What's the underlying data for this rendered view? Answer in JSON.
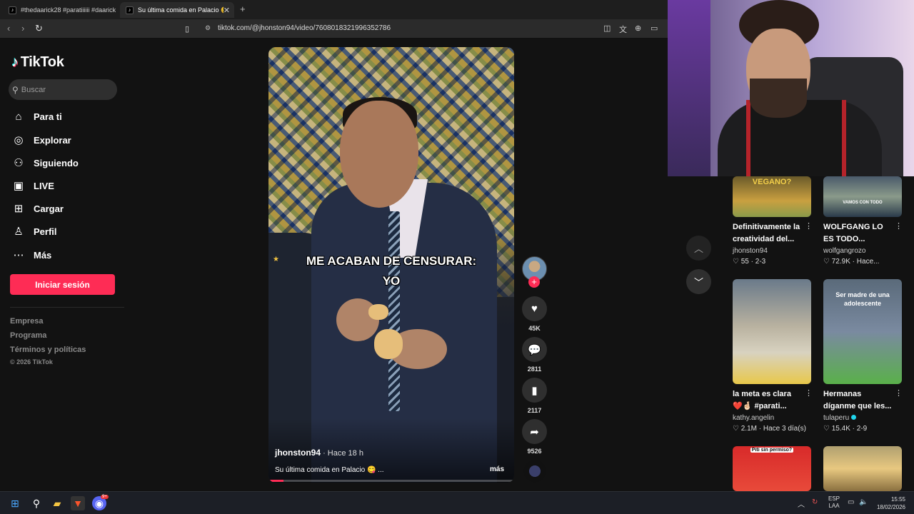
{
  "browser": {
    "tabs": [
      {
        "label": "#thedaarick28 #paratiiiiii #daarick #",
        "active": false
      },
      {
        "label": "Su última comida en Palacio 😋 |",
        "active": true
      }
    ],
    "url": "tiktok.com/@jhonston94/video/7608018321996352786"
  },
  "sidebar": {
    "brand": "TikTok",
    "search_placeholder": "Buscar",
    "nav": [
      {
        "label": "Para ti",
        "icon": "home-icon"
      },
      {
        "label": "Explorar",
        "icon": "compass-icon"
      },
      {
        "label": "Siguiendo",
        "icon": "following-icon"
      },
      {
        "label": "LIVE",
        "icon": "live-icon"
      },
      {
        "label": "Cargar",
        "icon": "upload-icon"
      },
      {
        "label": "Perfil",
        "icon": "profile-icon"
      },
      {
        "label": "Más",
        "icon": "more-icon"
      }
    ],
    "login_label": "Iniciar sesión",
    "footer_links": [
      "Empresa",
      "Programa",
      "Términos y políticas"
    ],
    "copyright": "© 2026 TikTok"
  },
  "video": {
    "overlay_line1": "ME ACABAN DE CENSURAR:",
    "overlay_line2": "YO",
    "author": "jhonston94",
    "time": " · Hace 18 h",
    "caption": "Su última comida en Palacio 😋 ...",
    "more": "más",
    "progress": 0.06
  },
  "actions": {
    "likes": "45K",
    "comments": "2811",
    "saves": "2117",
    "shares": "9526"
  },
  "related": [
    {
      "thumb_text": "VEGANO?",
      "title": "Definitivamente la creatividad del...",
      "author": "jhonston94",
      "likes": "55",
      "meta": "2-3",
      "verified": false
    },
    {
      "thumb_text": "VAMOS CON TODO",
      "title": "WOLFGANG LO ES TODO...",
      "author": "wolfgangrozo",
      "likes": "72.9K",
      "meta": "Hace...",
      "verified": false
    },
    {
      "thumb_text": "",
      "title": "la meta es clara ❤️🤞🏻 #parati...",
      "author": "kathy.angelin",
      "likes": "2.1M",
      "meta": "Hace 3 día(s)",
      "verified": false
    },
    {
      "thumb_text": "Ser madre de una adolescente",
      "title": "Hermanas díganme que les...",
      "author": "tulaperu",
      "likes": "15.4K",
      "meta": "2-9",
      "verified": true
    },
    {
      "thumb_text": "Piti sin permiso?",
      "title": "",
      "author": "",
      "likes": "",
      "meta": "",
      "verified": false
    },
    {
      "thumb_text": "",
      "title": "",
      "author": "",
      "likes": "",
      "meta": "",
      "verified": false
    }
  ],
  "taskbar": {
    "lang_line1": "ESP",
    "lang_line2": "LAA",
    "time": "15:55",
    "date": "18/02/2026",
    "discord_badge": "9+"
  },
  "colors": {
    "accent": "#fe2c55",
    "background": "#121212",
    "panel": "#2f2f2f"
  }
}
